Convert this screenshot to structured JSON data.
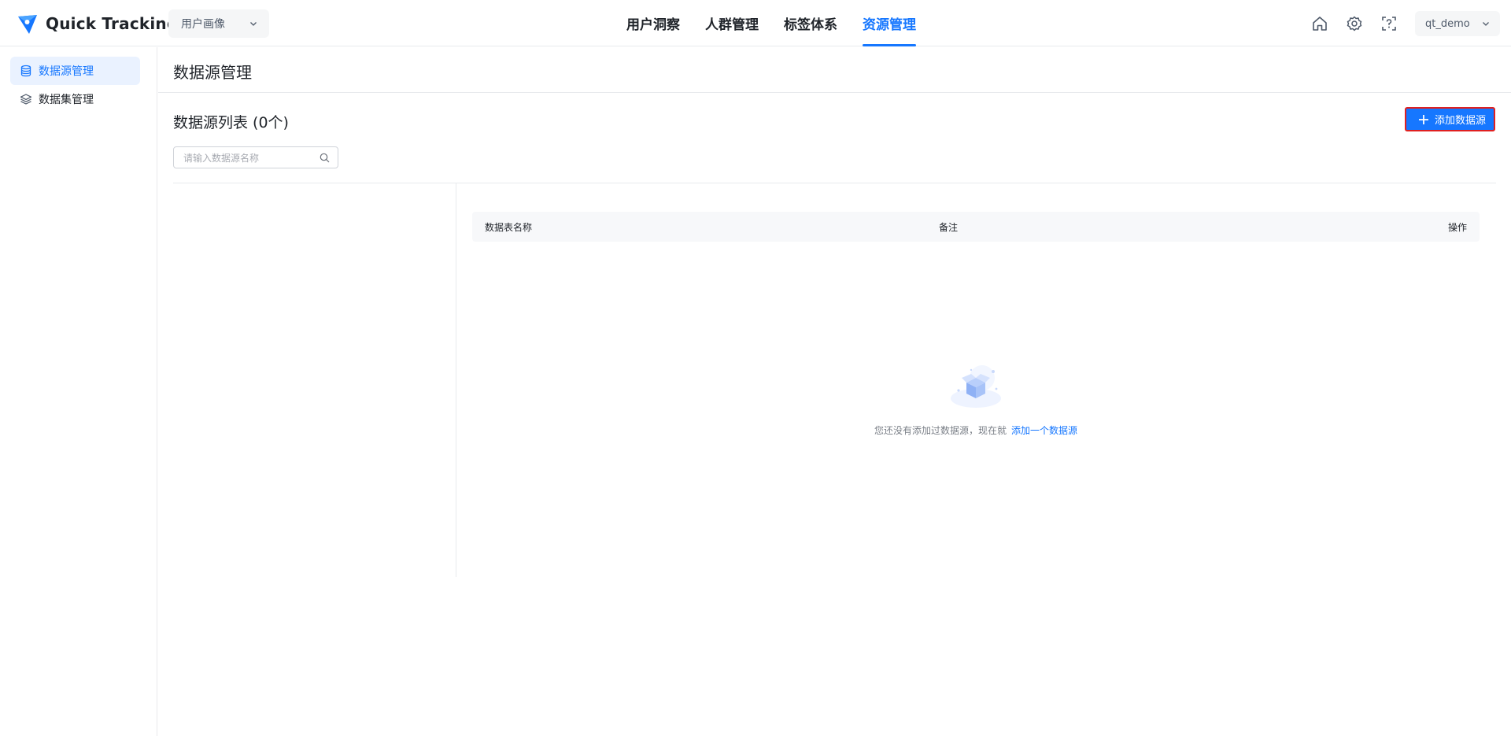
{
  "header": {
    "logo_text": "Quick Tracking",
    "app_select": "用户画像",
    "nav": [
      {
        "label": "用户洞察"
      },
      {
        "label": "人群管理"
      },
      {
        "label": "标签体系"
      },
      {
        "label": "资源管理",
        "active": true
      }
    ],
    "icons": [
      "home-icon",
      "gear-icon",
      "help-scan-icon"
    ],
    "user": "qt_demo"
  },
  "sidebar": {
    "items": [
      {
        "label": "数据源管理",
        "icon": "database-icon",
        "active": true
      },
      {
        "label": "数据集管理",
        "icon": "layers-icon",
        "active": false
      }
    ]
  },
  "main": {
    "page_title": "数据源管理",
    "list_title": "数据源列表 (0个)",
    "add_button": "添加数据源",
    "search_placeholder": "请输入数据源名称",
    "table": {
      "columns": [
        "数据表名称",
        "备注",
        "操作"
      ]
    },
    "empty": {
      "text": "您还没有添加过数据源，现在就",
      "link": "添加一个数据源"
    }
  },
  "colors": {
    "accent": "#1677ff",
    "highlight_border": "#e02020"
  }
}
